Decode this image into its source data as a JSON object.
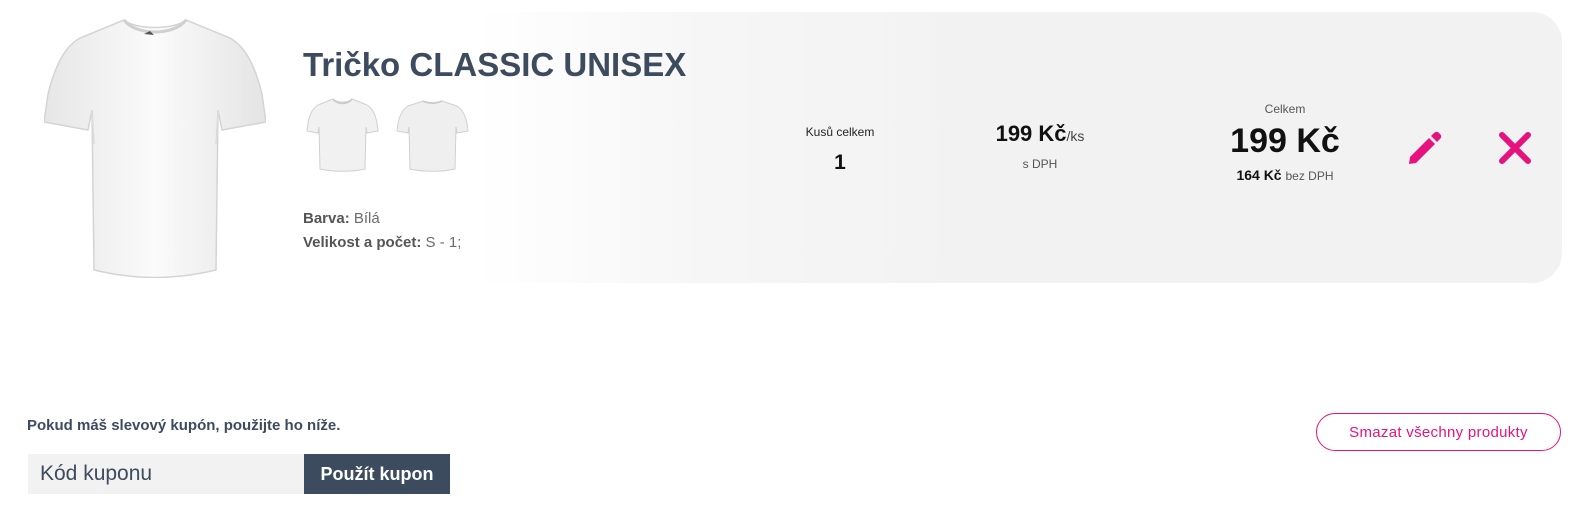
{
  "product": {
    "title": "Tričko CLASSIC UNISEX",
    "main_image_icon": "white-tshirt-front-image",
    "thumbnails": [
      {
        "icon": "white-tshirt-front-thumbnail"
      },
      {
        "icon": "white-tshirt-back-thumbnail"
      }
    ],
    "attributes": [
      {
        "label": "Barva:",
        "value": "Bílá"
      },
      {
        "label": "Velikost a počet:",
        "value": "S - 1;"
      }
    ]
  },
  "quantity": {
    "label": "Kusů celkem",
    "value": "1"
  },
  "unit_price": {
    "value": "199 Kč",
    "suffix": "/ks",
    "vat_note": "s DPH"
  },
  "total": {
    "label": "Celkem",
    "value": "199 Kč",
    "net_value": "164 Kč",
    "net_label": "bez DPH"
  },
  "actions": {
    "edit_icon": "pencil-icon",
    "delete_icon": "close-icon"
  },
  "coupon": {
    "hint": "Pokud máš slevový kupón, použijte ho níže.",
    "input_placeholder": "Kód kuponu",
    "input_value": "",
    "apply_label": "Použít kupon"
  },
  "clear_cart_label": "Smazat všechny produkty",
  "colors": {
    "accent_pink": "#e6127d",
    "slate": "#3d4b5f",
    "panel_gray": "#f2f2f2"
  }
}
